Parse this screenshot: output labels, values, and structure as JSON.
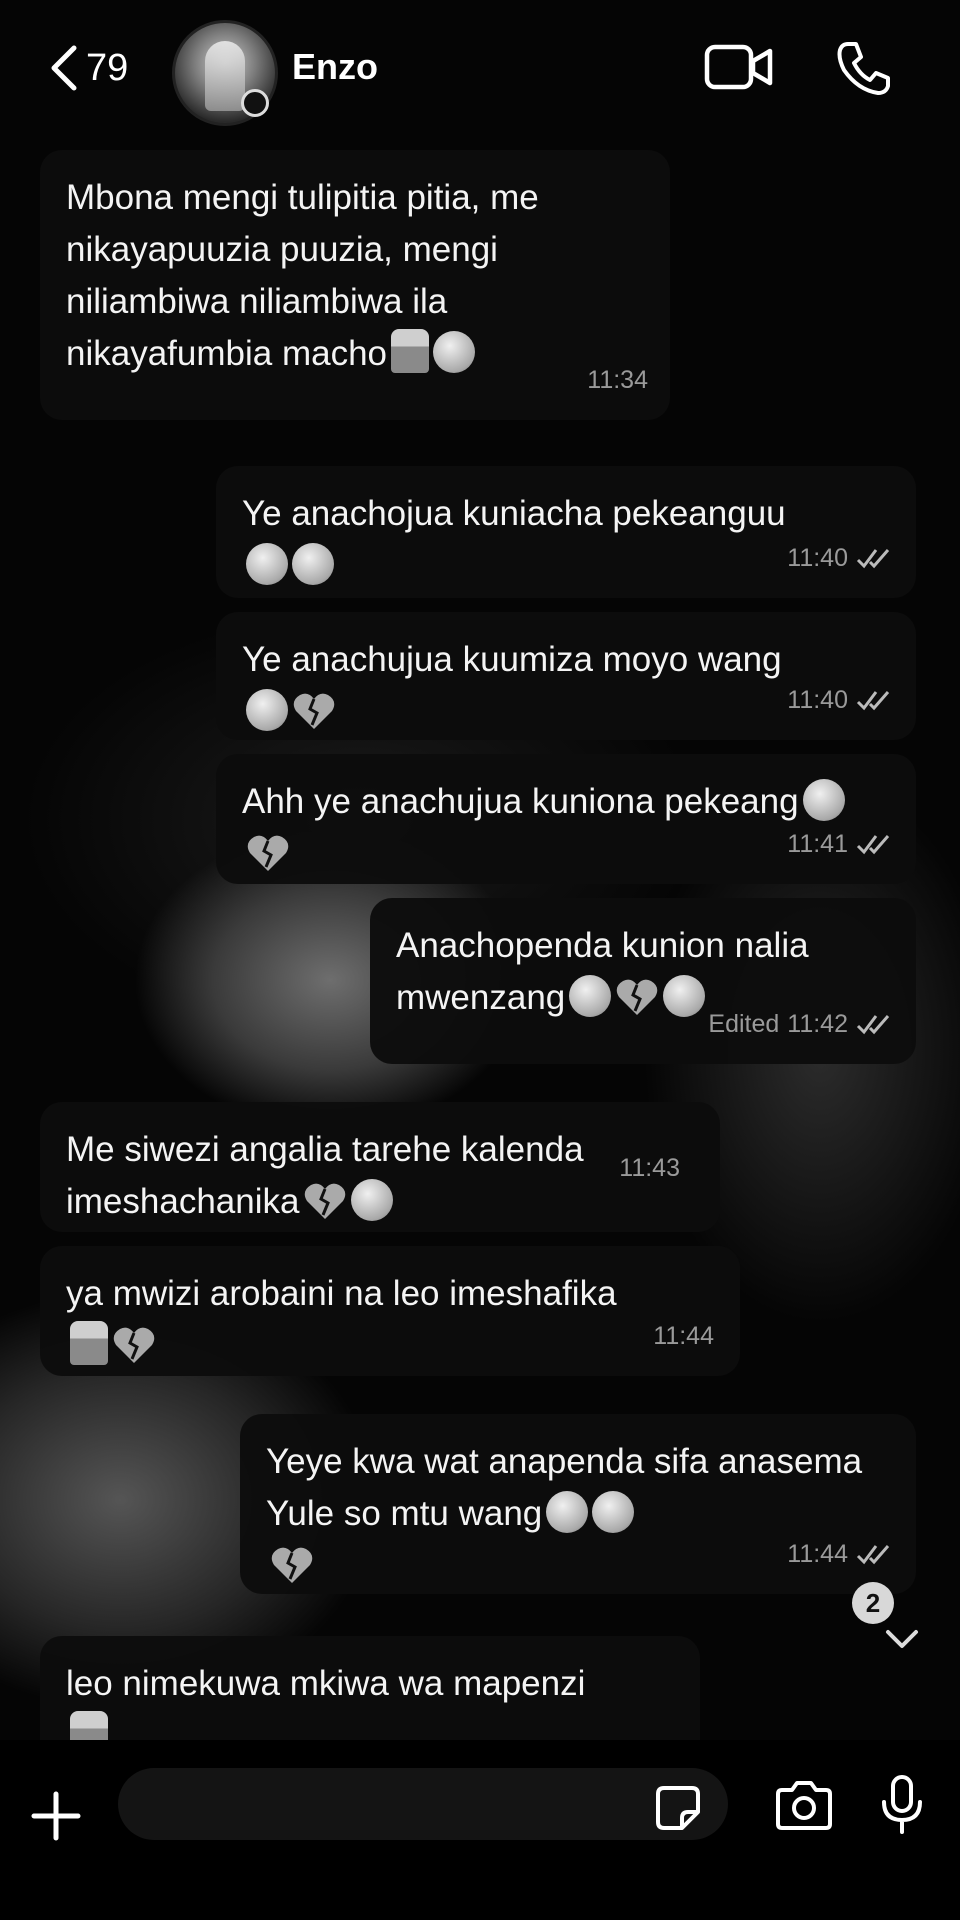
{
  "header": {
    "back_count": "79",
    "contact_name": "Enzo",
    "icons": {
      "back": "chevron-left-icon",
      "video": "video-camera-icon",
      "call": "phone-icon"
    }
  },
  "messages": [
    {
      "direction": "incoming",
      "text": "Mbona mengi tulipitia pitia, me nikayapuuzia puuzia, mengi niliambiwa niliambiwa ila nikayafumbia macho",
      "emojis": [
        "person-emoji",
        "smiling-face-emoji"
      ],
      "time": "11:34",
      "edited": false
    },
    {
      "direction": "outgoing",
      "text": "Ye anachojua kuniacha pekeanguu",
      "emojis": [
        "tired-face-emoji",
        "tired-face-emoji"
      ],
      "time": "11:40",
      "edited": false,
      "read": true
    },
    {
      "direction": "outgoing",
      "text": "Ye anachujua kuumiza moyo wang",
      "emojis": [
        "smiling-face-emoji",
        "broken-heart-emoji"
      ],
      "time": "11:40",
      "edited": false,
      "read": true
    },
    {
      "direction": "outgoing",
      "text": "Ahh ye anachujua kuniona pekeang",
      "emojis": [
        "pensive-face-emoji",
        "broken-heart-emoji"
      ],
      "time": "11:41",
      "edited": false,
      "read": true
    },
    {
      "direction": "outgoing",
      "text": "Anachopenda kunion nalia mwenzang",
      "emojis": [
        "pensive-face-emoji",
        "broken-heart-emoji",
        "smiling-face-emoji"
      ],
      "time": "11:42",
      "edited": true,
      "edited_label": "Edited",
      "read": true
    },
    {
      "direction": "incoming",
      "text": "Me siwezi angalia tarehe kalenda imeshachanika",
      "emojis": [
        "broken-heart-emoji",
        "pleading-face-emoji"
      ],
      "time": "11:43",
      "edited": false
    },
    {
      "direction": "incoming",
      "text": "ya mwizi arobaini na leo imeshafika",
      "emojis": [
        "person-emoji",
        "broken-heart-emoji"
      ],
      "time": "11:44",
      "edited": false
    },
    {
      "direction": "outgoing",
      "text": "Yeye kwa wat anapenda sifa anasema Yule so mtu wang",
      "emojis": [
        "smiling-face-emoji",
        "smiling-face-emoji",
        "broken-heart-emoji"
      ],
      "time": "11:44",
      "edited": false,
      "read": true
    },
    {
      "direction": "incoming",
      "text": "leo nimekuwa mkiwa wa mapenzi",
      "emojis": [
        "person-emoji"
      ],
      "time": "",
      "edited": true
    }
  ],
  "unread_badge": "2",
  "composer": {
    "placeholder": "",
    "icons": {
      "plus": "plus-icon",
      "sticker": "sticker-icon",
      "camera": "camera-icon",
      "mic": "microphone-icon"
    }
  },
  "colors": {
    "background": "#0a0a0a",
    "bubble": "#0c0c0c",
    "text": "#f4f4f4",
    "meta": "#9a9a9a"
  }
}
